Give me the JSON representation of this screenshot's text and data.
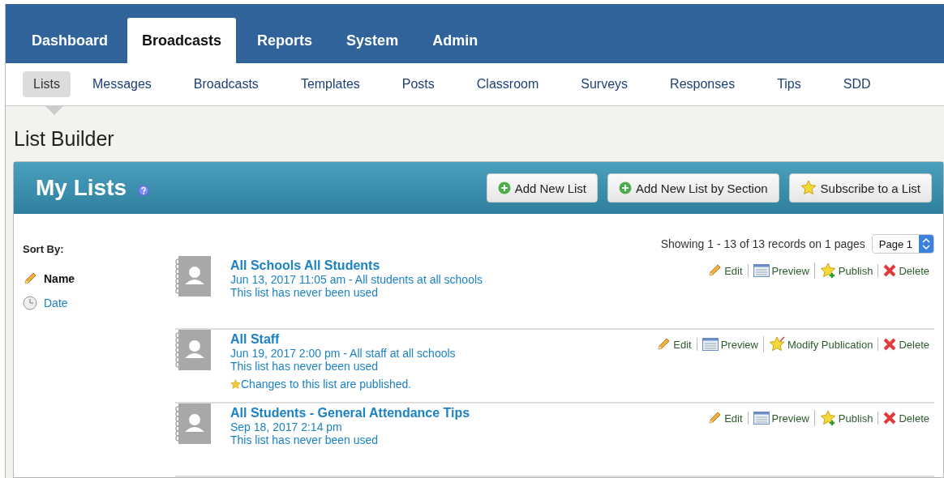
{
  "main_tabs": [
    {
      "label": "Dashboard",
      "selected": false
    },
    {
      "label": "Broadcasts",
      "selected": true
    },
    {
      "label": "Reports",
      "selected": false
    },
    {
      "label": "System",
      "selected": false
    },
    {
      "label": "Admin",
      "selected": false
    }
  ],
  "sub_tabs": [
    {
      "label": "Lists",
      "selected": true
    },
    {
      "label": "Messages",
      "selected": false
    },
    {
      "label": "Broadcasts",
      "selected": false
    },
    {
      "label": "Templates",
      "selected": false
    },
    {
      "label": "Posts",
      "selected": false
    },
    {
      "label": "Classroom",
      "selected": false
    },
    {
      "label": "Surveys",
      "selected": false
    },
    {
      "label": "Responses",
      "selected": false
    },
    {
      "label": "Tips",
      "selected": false
    },
    {
      "label": "SDD",
      "selected": false
    }
  ],
  "page_title": "List Builder",
  "panel": {
    "title": "My Lists",
    "buttons": [
      {
        "label": "Add New List",
        "kind": "add"
      },
      {
        "label": "Add New List by Section",
        "kind": "add"
      },
      {
        "label": "Subscribe to a List",
        "kind": "star"
      }
    ]
  },
  "sort": {
    "label": "Sort By:",
    "options": [
      {
        "label": "Name",
        "kind": "name",
        "selected": true
      },
      {
        "label": "Date",
        "kind": "date",
        "selected": false
      }
    ]
  },
  "pagination": {
    "summary": "Showing 1 - 13 of 13 records on 1 pages",
    "page": "Page 1"
  },
  "lists": [
    {
      "name": "All Schools All Students",
      "meta": "Jun 13, 2017 11:05 am - All students at all schools",
      "usage": "This list has never been used",
      "actions": [
        {
          "label": "Edit",
          "kind": "edit"
        },
        {
          "label": "Preview",
          "kind": "preview"
        },
        {
          "label": "Publish",
          "kind": "publish"
        },
        {
          "label": "Delete",
          "kind": "delete"
        }
      ]
    },
    {
      "name": "All Staff",
      "meta": "Jun 19, 2017 2:00 pm - All staff at all schools",
      "usage": "This list has never been used",
      "note": "Changes to this list are published.",
      "actions": [
        {
          "label": "Edit",
          "kind": "edit"
        },
        {
          "label": "Preview",
          "kind": "preview"
        },
        {
          "label": "Modify Publication",
          "kind": "modify"
        },
        {
          "label": "Delete",
          "kind": "delete"
        }
      ]
    },
    {
      "name": "All Students - General Attendance Tips",
      "meta": "Sep 18, 2017 2:14 pm",
      "usage": "This list has never been used",
      "actions": [
        {
          "label": "Edit",
          "kind": "edit"
        },
        {
          "label": "Preview",
          "kind": "preview"
        },
        {
          "label": "Publish",
          "kind": "publish"
        },
        {
          "label": "Delete",
          "kind": "delete"
        }
      ]
    }
  ]
}
